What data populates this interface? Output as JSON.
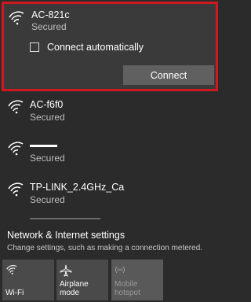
{
  "selected_network": {
    "name": "AC-821c",
    "status": "Secured",
    "auto_connect_label": "Connect automatically",
    "connect_button": "Connect"
  },
  "networks": [
    {
      "name": "AC-f6f0",
      "status": "Secured"
    },
    {
      "name": "",
      "status": "Secured"
    },
    {
      "name": "TP-LINK_2.4GHz_Ca",
      "status": "Secured"
    }
  ],
  "settings": {
    "title": "Network & Internet settings",
    "description": "Change settings, such as making a connection metered."
  },
  "quick_actions": [
    {
      "label": "Wi-Fi",
      "icon": "wifi-icon",
      "enabled": true
    },
    {
      "label": "Airplane mode",
      "icon": "airplane-icon",
      "enabled": true
    },
    {
      "label": "Mobile hotspot",
      "icon": "hotspot-icon",
      "enabled": false
    }
  ],
  "colors": {
    "background": "#2b2b2b",
    "selection_border": "#d0191f",
    "button": "#606060",
    "status_text": "#bdbdbd"
  }
}
